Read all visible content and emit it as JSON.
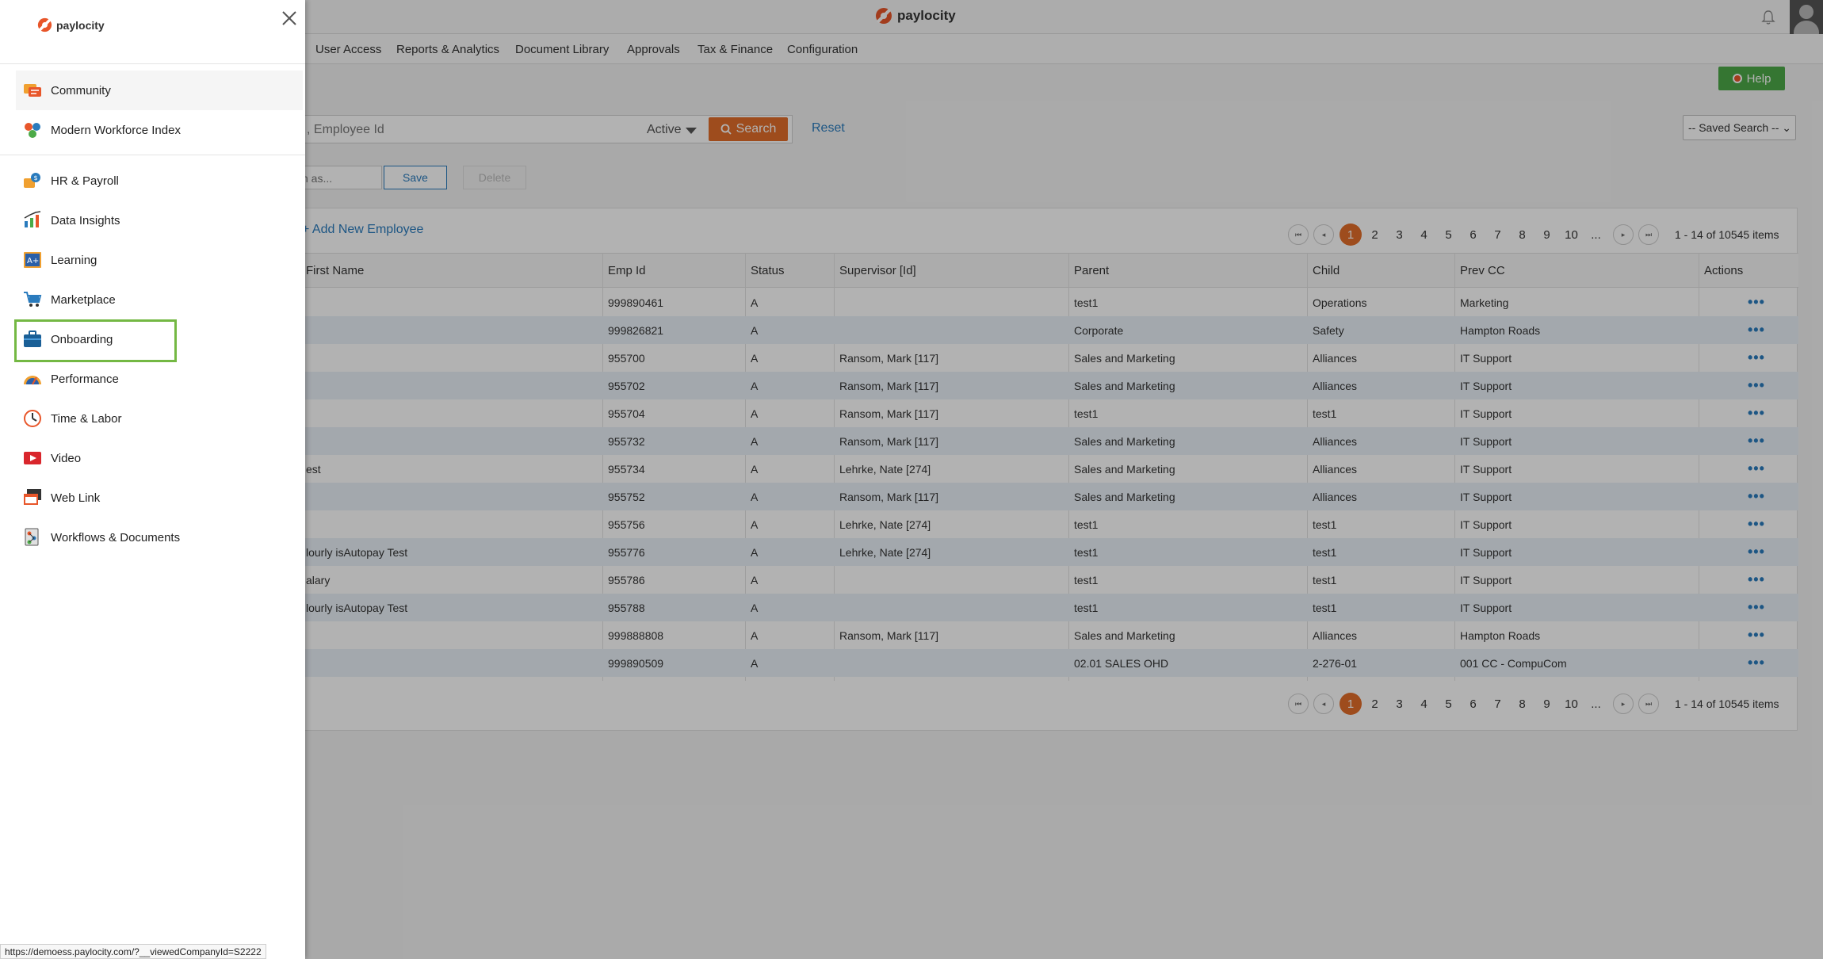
{
  "brand": {
    "name": "paylocity",
    "accent": "#e8562a"
  },
  "top_nav": [
    "User Access",
    "Reports & Analytics",
    "Document Library",
    "Approvals",
    "Tax & Finance",
    "Configuration"
  ],
  "help_label": "Help",
  "search": {
    "placeholder": ", Employee Id",
    "status_value": "Active",
    "search_label": "Search",
    "reset_label": "Reset",
    "saved_search_value": "-- Saved Search --",
    "save_as_placeholder": "h as...",
    "save_label": "Save",
    "delete_label": "Delete"
  },
  "table": {
    "add_new_label": "+ Add New Employee",
    "pages": [
      "1",
      "2",
      "3",
      "4",
      "5",
      "6",
      "7",
      "8",
      "9",
      "10",
      "..."
    ],
    "summary": "1 - 14 of 10545 items",
    "columns": [
      "First Name",
      "Emp Id",
      "Status",
      "Supervisor [Id]",
      "Parent",
      "Child",
      "Prev CC",
      "Actions"
    ],
    "rows": [
      [
        "",
        "999890461",
        "A",
        "",
        "test1",
        "Operations",
        "Marketing"
      ],
      [
        "",
        "999826821",
        "A",
        "",
        "Corporate",
        "Safety",
        "Hampton Roads"
      ],
      [
        "",
        "955700",
        "A",
        "Ransom, Mark [117]",
        "Sales and Marketing",
        "Alliances",
        "IT Support"
      ],
      [
        "",
        "955702",
        "A",
        "Ransom, Mark [117]",
        "Sales and Marketing",
        "Alliances",
        "IT Support"
      ],
      [
        "",
        "955704",
        "A",
        "Ransom, Mark [117]",
        "test1",
        "test1",
        "IT Support"
      ],
      [
        "",
        "955732",
        "A",
        "Ransom, Mark [117]",
        "Sales and Marketing",
        "Alliances",
        "IT Support"
      ],
      [
        "est",
        "955734",
        "A",
        "Lehrke, Nate [274]",
        "Sales and Marketing",
        "Alliances",
        "IT Support"
      ],
      [
        "",
        "955752",
        "A",
        "Ransom, Mark [117]",
        "Sales and Marketing",
        "Alliances",
        "IT Support"
      ],
      [
        "",
        "955756",
        "A",
        "Lehrke, Nate [274]",
        "test1",
        "test1",
        "IT Support"
      ],
      [
        "lourly isAutopay Test",
        "955776",
        "A",
        "Lehrke, Nate [274]",
        "test1",
        "test1",
        "IT Support"
      ],
      [
        "alary",
        "955786",
        "A",
        "",
        "test1",
        "test1",
        "IT Support"
      ],
      [
        "lourly isAutopay Test",
        "955788",
        "A",
        "",
        "test1",
        "test1",
        "IT Support"
      ],
      [
        "",
        "999888808",
        "A",
        "Ransom, Mark [117]",
        "Sales and Marketing",
        "Alliances",
        "Hampton Roads"
      ],
      [
        "",
        "999890509",
        "A",
        "",
        "02.01 SALES OHD",
        "2-276-01",
        "001 CC - CompuCom"
      ]
    ],
    "actions_glyph": "•••"
  },
  "drawer": {
    "menu": [
      {
        "label": "Community",
        "icon": "community-icon"
      },
      {
        "label": "Modern Workforce Index",
        "icon": "modern-workforce-index-icon"
      },
      {
        "label": "HR & Payroll",
        "icon": "hr-payroll-icon"
      },
      {
        "label": "Data Insights",
        "icon": "data-insights-icon"
      },
      {
        "label": "Learning",
        "icon": "learning-icon"
      },
      {
        "label": "Marketplace",
        "icon": "marketplace-icon"
      },
      {
        "label": "Onboarding",
        "icon": "onboarding-icon"
      },
      {
        "label": "Performance",
        "icon": "performance-icon"
      },
      {
        "label": "Time & Labor",
        "icon": "time-labor-icon"
      },
      {
        "label": "Video",
        "icon": "video-icon"
      },
      {
        "label": "Web Link",
        "icon": "web-link-icon"
      },
      {
        "label": "Workflows & Documents",
        "icon": "workflows-documents-icon"
      }
    ],
    "highlighted": "Onboarding",
    "highlight_color": "#74b843"
  },
  "status_url": "https://demoess.paylocity.com/?__viewedCompanyId=S2222"
}
